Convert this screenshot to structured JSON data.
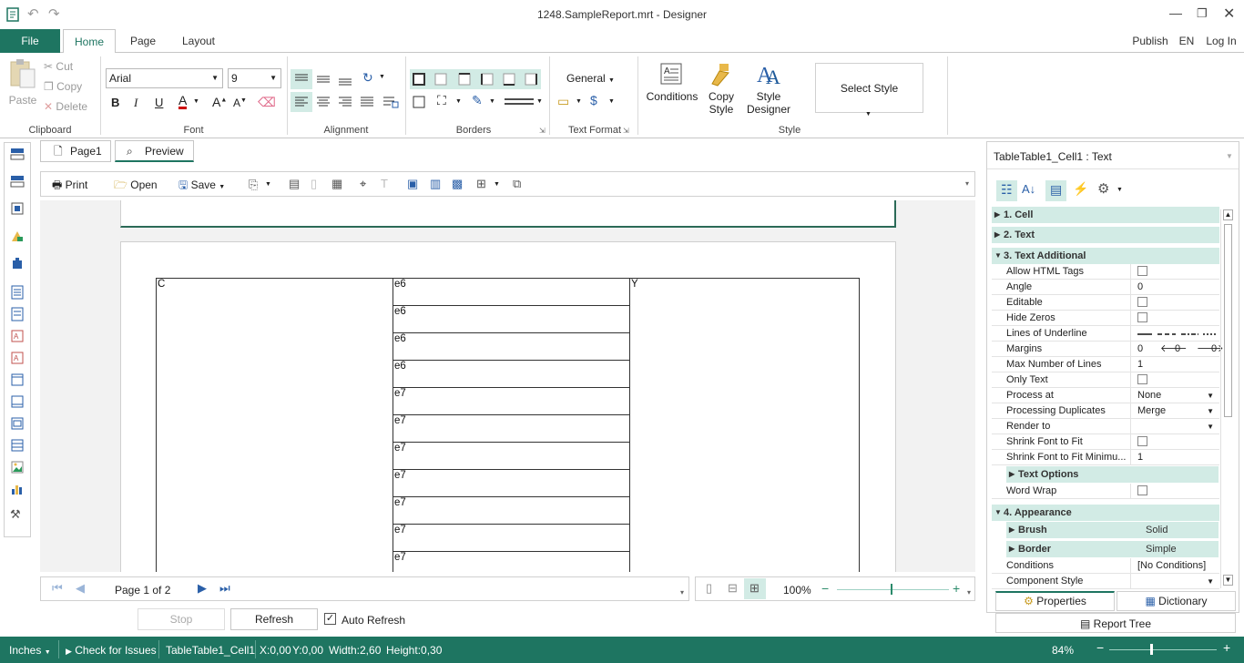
{
  "window": {
    "title": "1248.SampleReport.mrt - Designer"
  },
  "menu": {
    "file": "File",
    "tabs": [
      "Home",
      "Page",
      "Layout"
    ],
    "right": {
      "publish": "Publish",
      "lang": "EN",
      "login": "Log In"
    }
  },
  "ribbon": {
    "clipboard": {
      "paste": "Paste",
      "cut": "Cut",
      "copy": "Copy",
      "delete": "Delete",
      "label": "Clipboard"
    },
    "font": {
      "family": "Arial",
      "size": "9",
      "label": "Font"
    },
    "alignment": {
      "label": "Alignment"
    },
    "borders": {
      "label": "Borders"
    },
    "text_format": {
      "value": "General",
      "label": "Text Format"
    },
    "style": {
      "conditions": "Conditions",
      "copy_style_1": "Copy",
      "copy_style_2": "Style",
      "designer_1": "Style",
      "designer_2": "Designer",
      "select_style": "Select Style",
      "label": "Style"
    }
  },
  "doc_tabs": [
    "Page1",
    "Preview"
  ],
  "preview_toolbar": {
    "print": "Print",
    "open": "Open",
    "save": "Save"
  },
  "report": {
    "col1": "C",
    "col3": "Y",
    "col2_rows": [
      "e6",
      "e6",
      "e6",
      "e6",
      "e7",
      "e7",
      "e7",
      "e7",
      "e7",
      "e7",
      "e7"
    ]
  },
  "navigation": {
    "page_info": "Page 1 of 2",
    "zoom": "100%"
  },
  "buttons": {
    "stop": "Stop",
    "refresh": "Refresh",
    "auto_refresh": "Auto Refresh"
  },
  "properties": {
    "selected": "TableTable1_Cell1 : Text",
    "cat1": "1. Cell",
    "cat2": "2. Text",
    "cat3": "3. Text  Additional",
    "rows": [
      {
        "name": "Allow HTML Tags",
        "value": ""
      },
      {
        "name": "Angle",
        "value": "0"
      },
      {
        "name": "Editable",
        "value": ""
      },
      {
        "name": "Hide Zeros",
        "value": ""
      },
      {
        "name": "Lines of Underline",
        "value": ""
      },
      {
        "name": "Margins",
        "value": ""
      },
      {
        "name": "Max Number of Lines",
        "value": "1"
      },
      {
        "name": "Only Text",
        "value": ""
      },
      {
        "name": "Process at",
        "value": "None"
      },
      {
        "name": "Processing Duplicates",
        "value": "Merge"
      },
      {
        "name": "Render to",
        "value": ""
      },
      {
        "name": "Shrink Font to Fit",
        "value": ""
      },
      {
        "name": "Shrink Font to Fit Minimu...",
        "value": "1"
      }
    ],
    "margins": [
      "0",
      "0",
      "0"
    ],
    "text_options": "Text Options",
    "word_wrap": "Word Wrap",
    "cat4": "4. Appearance",
    "brush": {
      "name": "Brush",
      "value": "Solid"
    },
    "border": {
      "name": "Border",
      "value": "Simple"
    },
    "conditions": {
      "name": "Conditions",
      "value": "[No Conditions]"
    },
    "component_style": {
      "name": "Component Style",
      "value": ""
    },
    "tabs": {
      "properties": "Properties",
      "dictionary": "Dictionary"
    },
    "report_tree": "Report Tree"
  },
  "status": {
    "units": "Inches",
    "check": "Check for Issues",
    "component": "TableTable1_Cell1",
    "x": "X:0,00",
    "y": "Y:0,00",
    "width": "Width:2,60",
    "height": "Height:0,30",
    "zoom": "84%"
  },
  "colors": {
    "accent": "#1e7561",
    "highlight": "#d2ebe5"
  }
}
